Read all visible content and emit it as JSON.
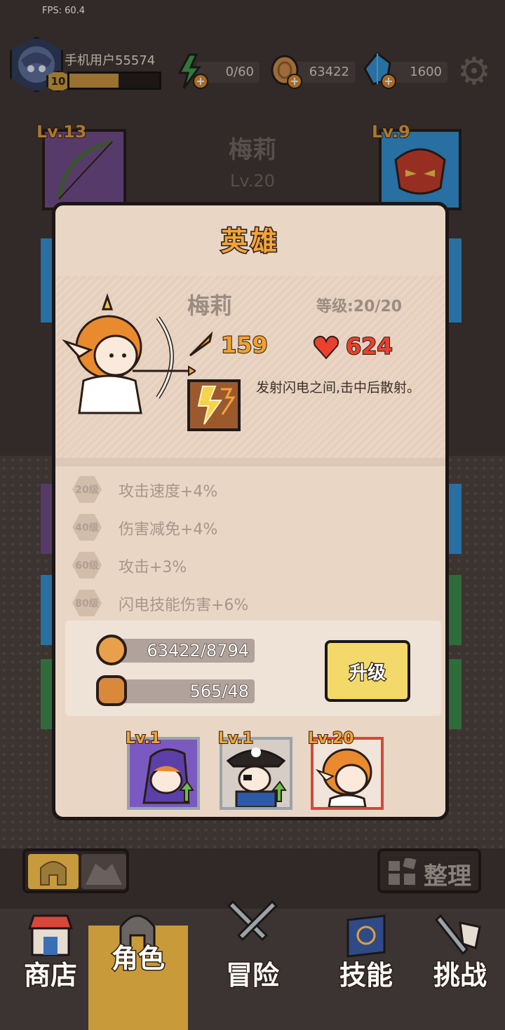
{
  "fps": "FPS: 60.4",
  "player": {
    "name": "手机用户55574",
    "level": "10",
    "xp_fraction": 0.55
  },
  "resources": {
    "energy": "0/60",
    "gold": "63422",
    "gems": "1600"
  },
  "background": {
    "hero_name": "梅莉",
    "hero_level": "Lv.20",
    "left_equipment_level": "Lv.13",
    "right_equipment_level": "Lv.9"
  },
  "modal": {
    "title": "英雄",
    "hero_name": "梅莉",
    "hero_level": "等级:20/20",
    "attack": "159",
    "hp": "624",
    "skill_description": "发射闪电之间,击中后散射。",
    "bonuses": [
      {
        "tier": "20级",
        "text": "攻击速度+4%"
      },
      {
        "tier": "40级",
        "text": "伤害减免+4%"
      },
      {
        "tier": "60级",
        "text": "攻击+3%"
      },
      {
        "tier": "80级",
        "text": "闪电技能伤害+6%"
      }
    ],
    "costs": {
      "gold": "63422/8794",
      "token": "565/48"
    },
    "upgrade_label": "升级",
    "team": [
      {
        "level": "Lv.1",
        "icon": "wizard-hero-icon"
      },
      {
        "level": "Lv.1",
        "icon": "pirate-hero-icon"
      },
      {
        "level": "Lv.20",
        "icon": "archer-hero-icon"
      }
    ]
  },
  "controls": {
    "sort_label": "整理"
  },
  "nav": [
    {
      "label": "商店",
      "icon": "shop-icon"
    },
    {
      "label": "角色",
      "icon": "helmet-icon",
      "active": true
    },
    {
      "label": "冒险",
      "icon": "crossed-swords-icon"
    },
    {
      "label": "技能",
      "icon": "spellbook-icon"
    },
    {
      "label": "挑战",
      "icon": "sword-flag-icon"
    }
  ],
  "colors": {
    "accent": "#f2a33a",
    "gold": "#c79a3d",
    "hp": "#e9402f",
    "upgrade": "#f3d969"
  }
}
